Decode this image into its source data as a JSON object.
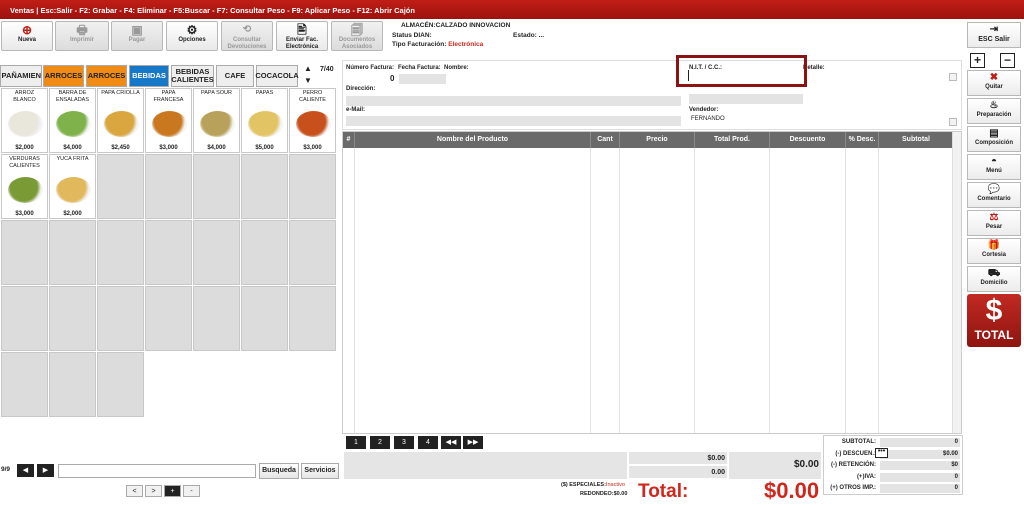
{
  "titlebar": {
    "text": "Ventas | Esc:Salir - F2: Grabar - F4: Eliminar - F5:Buscar - F7: Consultar Peso - F9: Aplicar Peso - F12: Abrir Cajón"
  },
  "toolbar": {
    "nueva": "Nueva",
    "imprimir": "Imprimir",
    "pagar": "Pagar",
    "opciones": "Opciones",
    "consultar_devoluciones": "Consultar Devoluciones",
    "enviar_fac": "Enviar Fac. Electrónica",
    "documentos_asociados": "Documentos Asociados"
  },
  "info": {
    "almacen": "ALMACÉN:CALZADO INNOVACION",
    "status_dian": "Status DIAN:",
    "estado_label": "Estado:",
    "estado_value": "...",
    "tipo_label": "Tipo Facturación:",
    "tipo_value": "Electrónica"
  },
  "categories": [
    "MPAÑAMIEN",
    "ARROCES",
    "ARROCES",
    "BEBIDAS",
    "BEBIDAS CALIENTES",
    "CAFE",
    "COCACOLA"
  ],
  "cat_page": "7/40",
  "products": [
    {
      "name": "ARROZ BLANCO",
      "price": "$2,000",
      "color": "#e9e6dc"
    },
    {
      "name": "BARRA DE ENSALADAS",
      "price": "$4,000",
      "color": "#7fb24a"
    },
    {
      "name": "PAPA CRIOLLA",
      "price": "$2,450",
      "color": "#d9a640"
    },
    {
      "name": "PAPA FRANCESA",
      "price": "$3,000",
      "color": "#c9781f"
    },
    {
      "name": "PAPA SOUR",
      "price": "$4,000",
      "color": "#b8a15a"
    },
    {
      "name": "PAPAS",
      "price": "$5,000",
      "color": "#e3c465"
    },
    {
      "name": "PERRO CALIENTE",
      "price": "$3,000",
      "color": "#c8501c"
    },
    {
      "name": "VERDURAS CALIENTES",
      "price": "$3,000",
      "color": "#7a9a36"
    },
    {
      "name": "YUCA FRITA",
      "price": "$2,000",
      "color": "#e2b85c"
    }
  ],
  "left_pager": {
    "page": "9/9",
    "busqueda": "Busqueda",
    "servicios": "Servicios"
  },
  "bottom_arrows": [
    "<",
    ">",
    "+",
    "-"
  ],
  "header": {
    "numero_factura": "Número Factura:",
    "fecha_factura": "Fecha Factura:",
    "nombre": "Nombre:",
    "numero_value": "0",
    "nit": "N.I.T. / C.C.:",
    "detalle": "Detalle:",
    "direccion": "Dirección:",
    "email": "e-Mail:",
    "vendedor": "Vendedor:",
    "vendedor_value": "FERNANDO"
  },
  "table": {
    "columns": [
      "#",
      "Nombre del Producto",
      "Cant",
      "Precio",
      "Total Prod.",
      "Descuento",
      "% Desc.",
      "Subtotal"
    ]
  },
  "table_pager": [
    "1",
    "2",
    "3",
    "4",
    "◀◀",
    "▶▶"
  ],
  "totals": {
    "val1": "$0.00",
    "val2": "0.00",
    "mid_total": "$0.00",
    "especiales_label": "($) ESPECIALES:",
    "especiales_value": "Inactivo",
    "redondeo_label": "REDONDEO:",
    "redondeo_value": "$0.00",
    "total_label": "Total:",
    "total_value": "$0.00"
  },
  "summary": [
    {
      "label": "SUBTOTAL:",
      "value": "0"
    },
    {
      "label": "(-) DESCUEN.:",
      "value": "$0.00"
    },
    {
      "label": "(-) RETENCIÓN:",
      "value": "$0"
    },
    {
      "label": "(+)IVA:",
      "value": "0"
    },
    {
      "label": "(+) OTROS IMP.:",
      "value": "0"
    }
  ],
  "right_buttons": {
    "esc_salir": "ESC Salir",
    "quitar": "Quitar",
    "preparacion": "Preparación",
    "composicion": "Composición",
    "menu": "Menú",
    "comentario": "Comentario",
    "pesar": "Pesar",
    "cortesia": "Cortesia",
    "domicilio": "Domicilio",
    "total": "TOTAL"
  },
  "colors": {
    "titlebar": "#b0160f",
    "accent_red": "#d0261c",
    "orange": "#f08b16",
    "blue": "#1878c8",
    "nit_border": "#8a1414"
  }
}
